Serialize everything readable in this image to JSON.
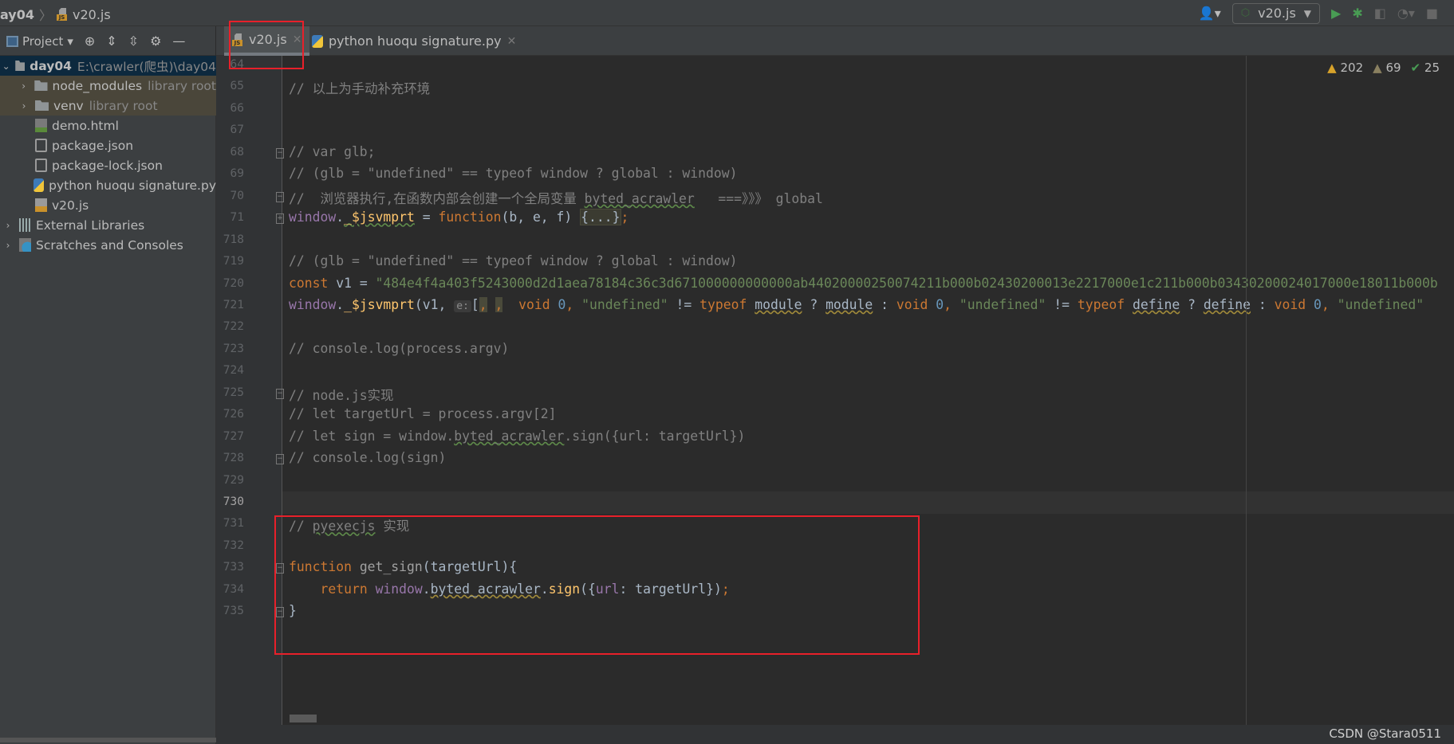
{
  "breadcrumb": {
    "project": "ay04",
    "file": "v20.js"
  },
  "toolbar": {
    "run_config": "v20.js",
    "run_config_icon": "nodejs-icon"
  },
  "project_panel": {
    "title": "Project",
    "dropdown": "▾"
  },
  "tabs": [
    {
      "label": "v20.js",
      "icon": "js-file-icon",
      "active": true
    },
    {
      "label": "python huoqu signature.py",
      "icon": "python-file-icon",
      "active": false
    }
  ],
  "tree": [
    {
      "label": "day04",
      "hint": "E:\\crawler(爬虫)\\day04",
      "type": "folder",
      "expanded": true,
      "selected": true,
      "depth": 0
    },
    {
      "label": "node_modules",
      "hint": "library root",
      "type": "folder",
      "expanded": false,
      "depth": 1
    },
    {
      "label": "venv",
      "hint": "library root",
      "type": "folder",
      "expanded": false,
      "depth": 1
    },
    {
      "label": "demo.html",
      "type": "html",
      "depth": 1
    },
    {
      "label": "package.json",
      "type": "json",
      "depth": 1
    },
    {
      "label": "package-lock.json",
      "type": "json",
      "depth": 1
    },
    {
      "label": "python huoqu signature.py",
      "type": "python",
      "depth": 1
    },
    {
      "label": "v20.js",
      "type": "js",
      "depth": 1
    },
    {
      "label": "External Libraries",
      "type": "libraries",
      "expanded": false,
      "depth": 0
    },
    {
      "label": "Scratches and Consoles",
      "type": "scratches",
      "expanded": false,
      "depth": 0
    }
  ],
  "inspections": {
    "warnings": "202",
    "weak_warnings": "69",
    "typos": "25"
  },
  "editor": {
    "current_line": "730",
    "lines": [
      {
        "n": "64",
        "tokens": []
      },
      {
        "n": "65",
        "tokens": [
          {
            "t": "// 以上为手动补充环境",
            "c": "comment"
          }
        ]
      },
      {
        "n": "66",
        "tokens": []
      },
      {
        "n": "67",
        "tokens": []
      },
      {
        "n": "68",
        "fold": "start",
        "tokens": [
          {
            "t": "// var glb;",
            "c": "comment"
          }
        ]
      },
      {
        "n": "69",
        "tokens": [
          {
            "t": "// (glb = \"undefined\" == typeof window ? global : window)",
            "c": "comment"
          }
        ]
      },
      {
        "n": "70",
        "fold": "end",
        "tokens": [
          {
            "t": "//  浏览器执行,在函数内部会创建一个全局变量 ",
            "c": "comment"
          },
          {
            "t": "byted_acrawler",
            "c": "cu"
          },
          {
            "t": "   ===》》》 global",
            "c": "comment"
          }
        ]
      },
      {
        "n": "71",
        "fold": "collapsed",
        "tokens": [
          {
            "t": "window",
            "c": "purple"
          },
          {
            "t": ".",
            "c": "plain"
          },
          {
            "t": "_$jsvmprt",
            "c": "fnu"
          },
          {
            "t": " = ",
            "c": "plain"
          },
          {
            "t": "function",
            "c": "kw"
          },
          {
            "t": "(b, e, f) ",
            "c": "plain"
          },
          {
            "t": "{...}",
            "c": "fold"
          },
          {
            "t": ";",
            "c": "kw"
          }
        ]
      },
      {
        "n": "718",
        "tokens": []
      },
      {
        "n": "719",
        "tokens": [
          {
            "t": "// (glb = \"undefined\" == typeof window ? global : window)",
            "c": "comment"
          }
        ]
      },
      {
        "n": "720",
        "tokens": [
          {
            "t": "const ",
            "c": "kw"
          },
          {
            "t": "v1 = ",
            "c": "plain"
          },
          {
            "t": "\"484e4f4a403f5243000d2d1aea78184c36c3d671000000000000ab44020000250074211b000b02430200013e2217000e1c211b000b03430200024017000e18011b000b",
            "c": "str"
          }
        ]
      },
      {
        "n": "721",
        "tokens": [
          {
            "t": "window",
            "c": "purple"
          },
          {
            "t": ".",
            "c": "plain"
          },
          {
            "t": "_$jsvmprt",
            "c": "fn"
          },
          {
            "t": "(v1, ",
            "c": "plain"
          },
          {
            "t": "e:",
            "c": "hint"
          },
          {
            "t": "[",
            "c": "plain"
          },
          {
            "t": ",",
            "c": "hl"
          },
          {
            "t": " ",
            "c": "plain"
          },
          {
            "t": ",",
            "c": "hl"
          },
          {
            "t": "  void ",
            "c": "kw"
          },
          {
            "t": "0",
            "c": "num"
          },
          {
            "t": ", ",
            "c": "kw"
          },
          {
            "t": "\"undefined\"",
            "c": "str"
          },
          {
            "t": " != ",
            "c": "plain"
          },
          {
            "t": "typeof ",
            "c": "kw"
          },
          {
            "t": "module",
            "c": "pu"
          },
          {
            "t": " ? ",
            "c": "plain"
          },
          {
            "t": "module",
            "c": "pu"
          },
          {
            "t": " : ",
            "c": "plain"
          },
          {
            "t": "void ",
            "c": "kw"
          },
          {
            "t": "0",
            "c": "num"
          },
          {
            "t": ", ",
            "c": "kw"
          },
          {
            "t": "\"undefined\"",
            "c": "str"
          },
          {
            "t": " != ",
            "c": "plain"
          },
          {
            "t": "typeof ",
            "c": "kw"
          },
          {
            "t": "define",
            "c": "pu"
          },
          {
            "t": " ? ",
            "c": "plain"
          },
          {
            "t": "define",
            "c": "pu"
          },
          {
            "t": " : ",
            "c": "plain"
          },
          {
            "t": "void ",
            "c": "kw"
          },
          {
            "t": "0",
            "c": "num"
          },
          {
            "t": ", ",
            "c": "kw"
          },
          {
            "t": "\"undefined\"",
            "c": "str"
          }
        ]
      },
      {
        "n": "722",
        "tokens": []
      },
      {
        "n": "723",
        "tokens": [
          {
            "t": "// console.log(process.argv)",
            "c": "comment"
          }
        ]
      },
      {
        "n": "724",
        "tokens": []
      },
      {
        "n": "725",
        "fold": "start",
        "tokens": [
          {
            "t": "// node.js实现",
            "c": "comment"
          }
        ]
      },
      {
        "n": "726",
        "tokens": [
          {
            "t": "// let targetUrl = process.argv[2]",
            "c": "comment"
          }
        ]
      },
      {
        "n": "727",
        "tokens": [
          {
            "t": "// let sign = window.",
            "c": "comment"
          },
          {
            "t": "byted_acrawler",
            "c": "cu"
          },
          {
            "t": ".sign({url: targetUrl})",
            "c": "comment"
          }
        ]
      },
      {
        "n": "728",
        "fold": "end",
        "tokens": [
          {
            "t": "// console.log(sign)",
            "c": "comment"
          }
        ]
      },
      {
        "n": "729",
        "tokens": []
      },
      {
        "n": "730",
        "tokens": []
      },
      {
        "n": "731",
        "tokens": [
          {
            "t": "// ",
            "c": "comment"
          },
          {
            "t": "pyexecjs",
            "c": "cu"
          },
          {
            "t": " 实现",
            "c": "comment"
          }
        ]
      },
      {
        "n": "732",
        "tokens": []
      },
      {
        "n": "733",
        "fold": "start",
        "tokens": [
          {
            "t": "function ",
            "c": "kw"
          },
          {
            "t": "get_sign",
            "c": "fndim"
          },
          {
            "t": "(targetUrl){",
            "c": "plain"
          }
        ]
      },
      {
        "n": "734",
        "tokens": [
          {
            "t": "    ",
            "c": "plain"
          },
          {
            "t": "return ",
            "c": "kw"
          },
          {
            "t": "window",
            "c": "purple"
          },
          {
            "t": ".",
            "c": "plain"
          },
          {
            "t": "byted_acrawler",
            "c": "pu"
          },
          {
            "t": ".",
            "c": "plain"
          },
          {
            "t": "sign",
            "c": "fn"
          },
          {
            "t": "({",
            "c": "plain"
          },
          {
            "t": "url",
            "c": "purple"
          },
          {
            "t": ": targetUrl})",
            "c": "plain"
          },
          {
            "t": ";",
            "c": "kw"
          }
        ]
      },
      {
        "n": "735",
        "fold": "end",
        "tokens": [
          {
            "t": "}",
            "c": "plain"
          }
        ]
      }
    ]
  },
  "watermark": "CSDN @Stara0511",
  "colors": {
    "annotation_box": "#e8202a",
    "keyword": "#cc7832",
    "string": "#6a8759",
    "comment": "#808080"
  }
}
